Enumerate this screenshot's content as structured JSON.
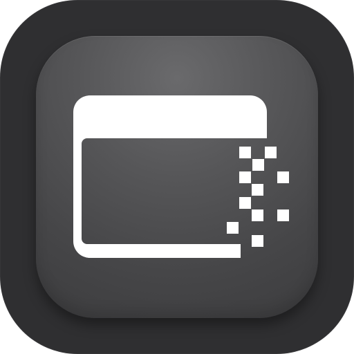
{
  "app_icon": {
    "icon_name": "window-pixelate-icon",
    "colors": {
      "outer_background": "#2f2f31",
      "inner_background": "#555557",
      "glyph": "#ffffff"
    }
  }
}
